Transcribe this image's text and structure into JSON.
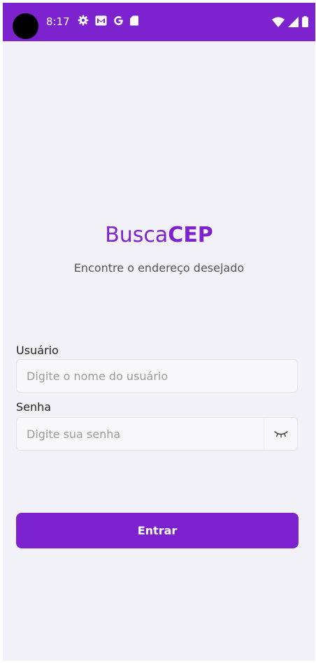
{
  "status_bar": {
    "time": "8:17",
    "icons_left": [
      "gear-icon",
      "gmail-icon",
      "google-icon",
      "sd-card-icon"
    ],
    "icons_right": [
      "wifi-icon",
      "signal-icon",
      "battery-icon"
    ]
  },
  "brand": {
    "regular": "Busca",
    "bold": "CEP"
  },
  "tagline": "Encontre o endereço desejado",
  "form": {
    "user_label": "Usuário",
    "user_placeholder": "Digite o nome do usuário",
    "password_label": "Senha",
    "password_placeholder": "Digite sua senha",
    "password_toggle_icon": "eye-closed-icon"
  },
  "submit_label": "Entrar",
  "colors": {
    "primary": "#7d22cf",
    "background": "#f2f1f7"
  }
}
